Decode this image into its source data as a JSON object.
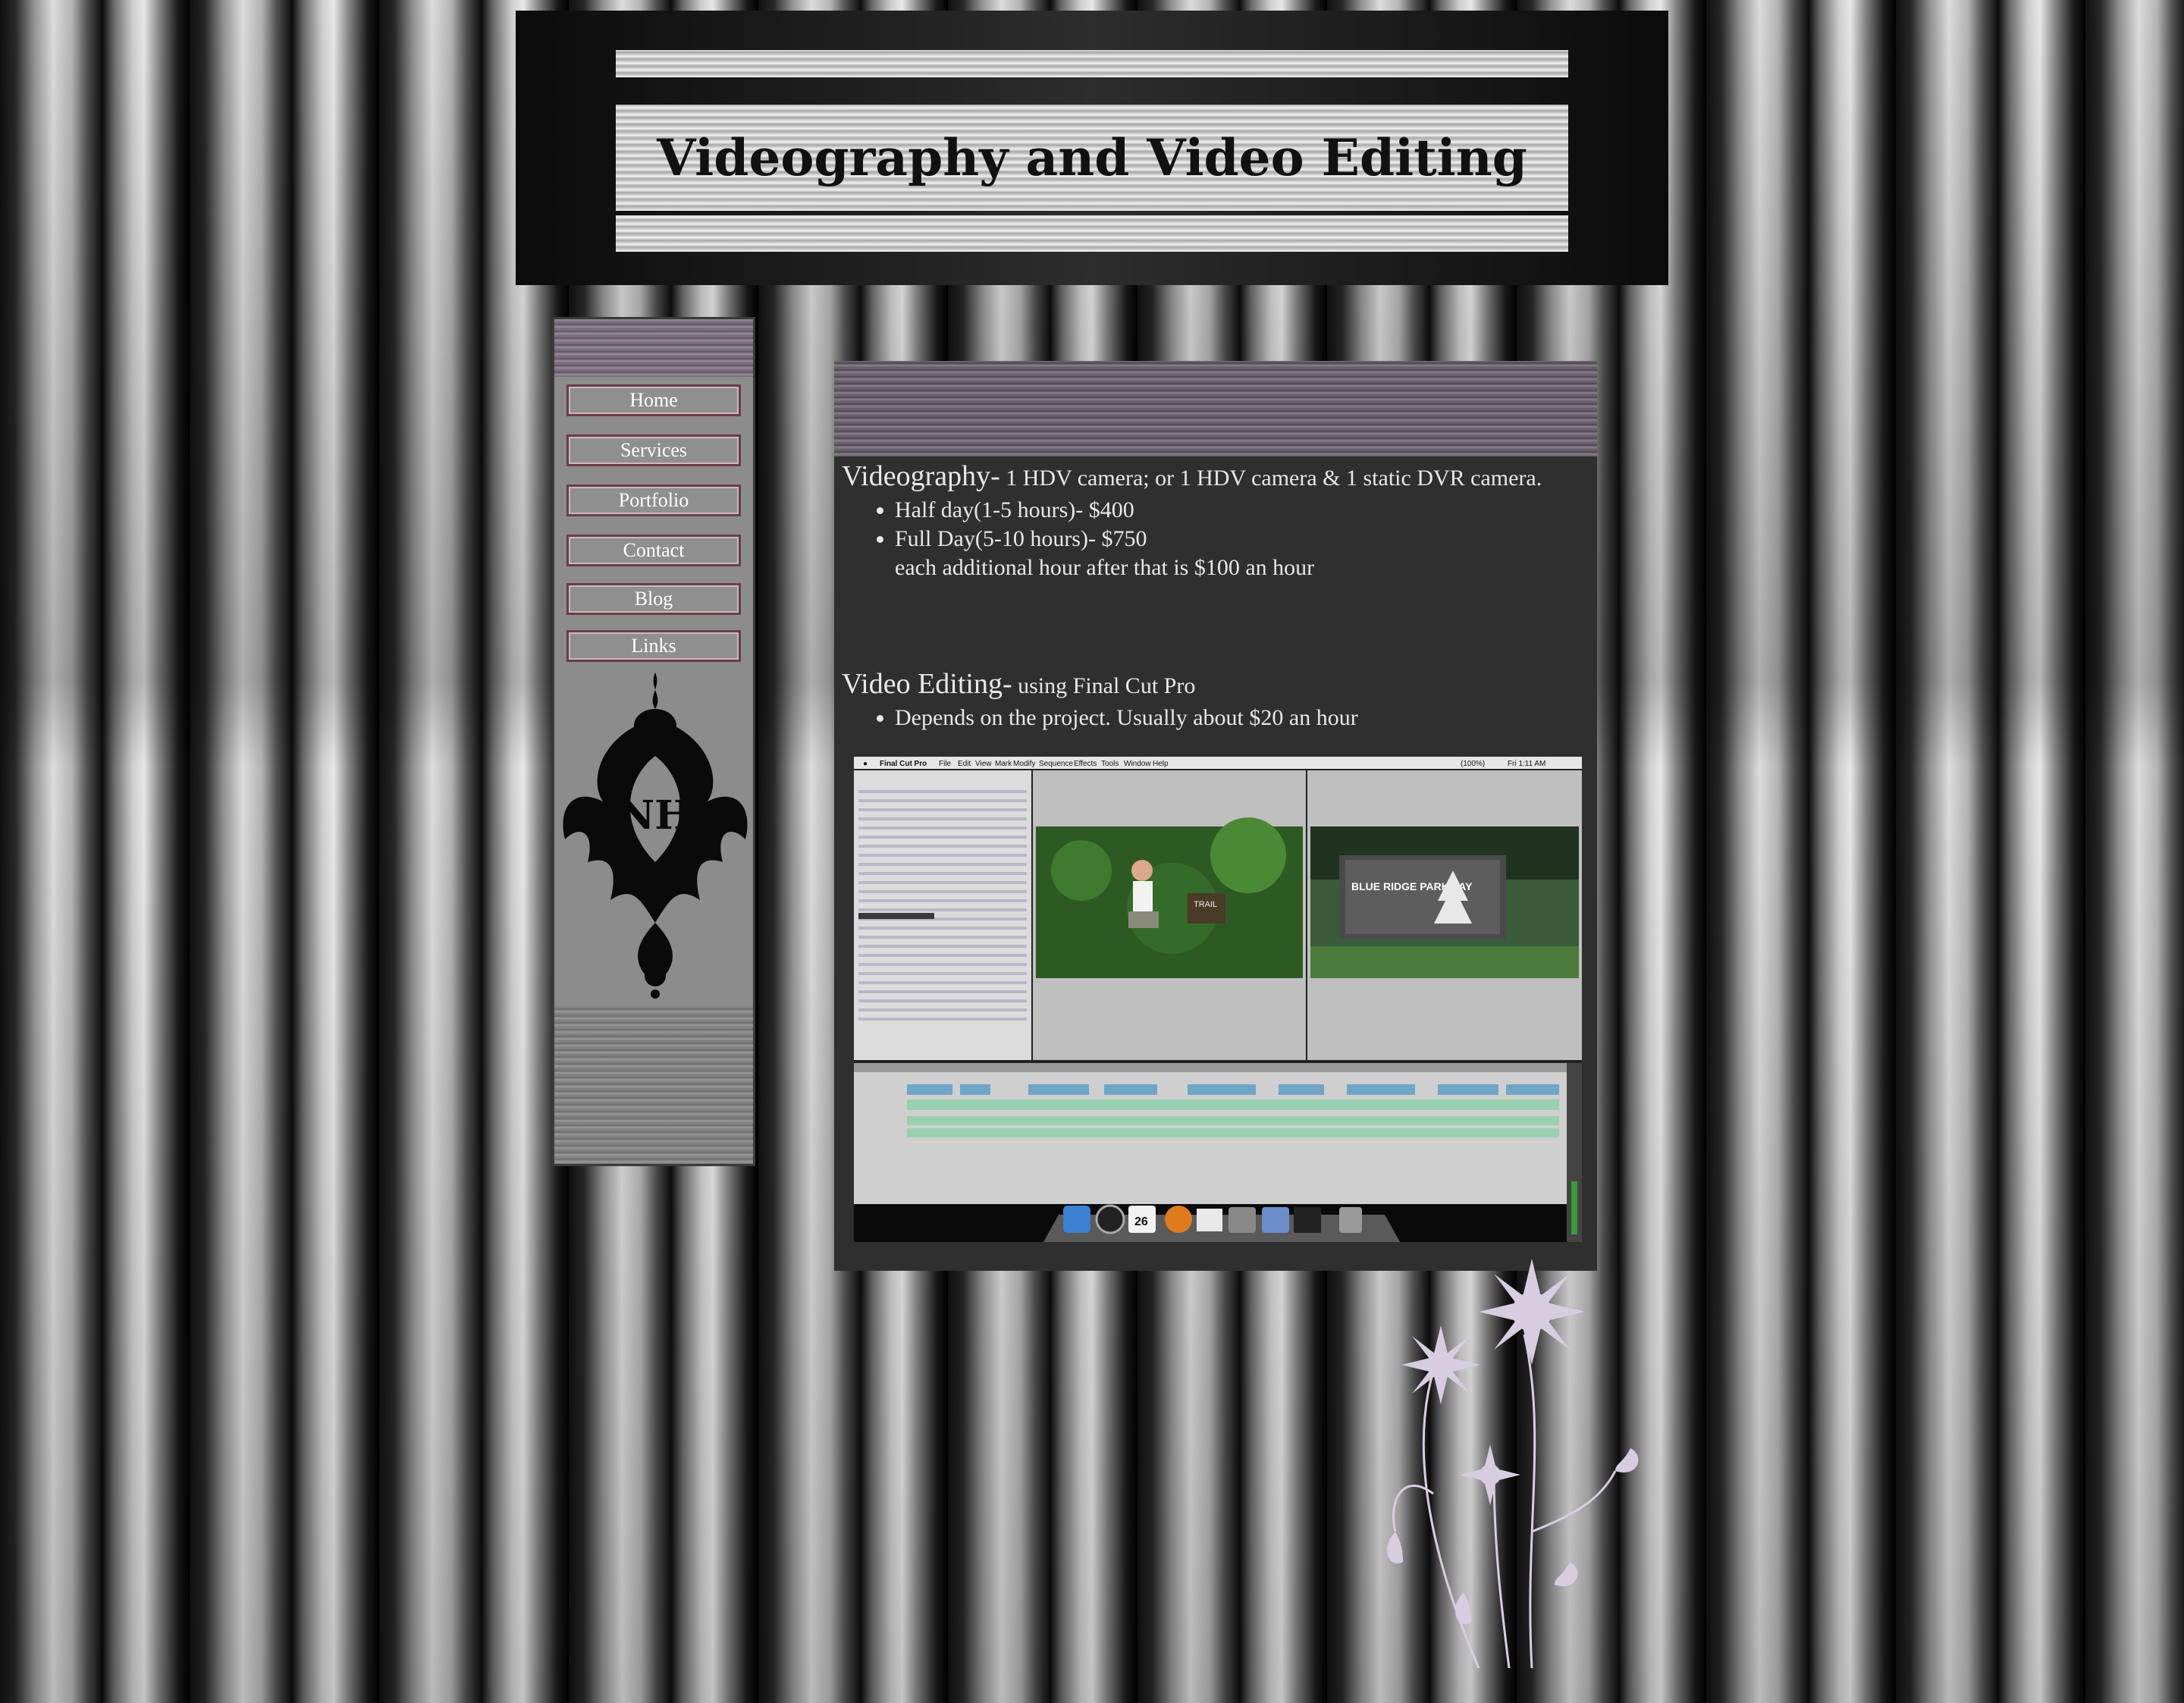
{
  "header": {
    "title": "Videography and Video Editing"
  },
  "nav": {
    "items": [
      {
        "label": "Home"
      },
      {
        "label": "Services"
      },
      {
        "label": "Portfolio"
      },
      {
        "label": "Contact"
      },
      {
        "label": "Blog"
      },
      {
        "label": "Links"
      }
    ]
  },
  "logo": {
    "monogram": "NH"
  },
  "videography": {
    "heading": "Videography-",
    "detail": " 1 HDV camera; or 1 HDV camera & 1 static DVR camera.",
    "items": [
      "Half day(1-5 hours)- $400",
      "Full Day(5-10 hours)- $750"
    ],
    "note": "each additional hour after that is $100 an hour"
  },
  "editing": {
    "heading": "Video Editing-",
    "detail": " using Final Cut Pro",
    "items": [
      "Depends on the project. Usually about $20 an hour"
    ]
  },
  "screenshot": {
    "app_name": "Final Cut Pro",
    "menu": [
      "File",
      "Edit",
      "View",
      "Mark",
      "Modify",
      "Sequence",
      "Effects",
      "Tools",
      "Window",
      "Help"
    ],
    "clock": "Fri 1:11 AM",
    "battery": "(100%)",
    "sign_text_1": "TRAIL",
    "sign_text_2": "BLUE RIDGE PARKWAY",
    "dock_date": "26"
  }
}
